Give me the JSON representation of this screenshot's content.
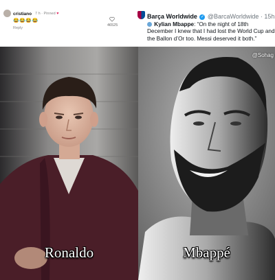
{
  "comment": {
    "username": "cristiano",
    "meta": "7 h · Pinned",
    "emojis": "😂😂😂😂",
    "reply_label": "Reply",
    "like_count": "46525"
  },
  "tweet": {
    "account_name": "Barça Worldwide",
    "handle": "@BarcaWorldwide · 15h",
    "mention": "Kylian Mbappe",
    "quote": ": “On the night of 18th December I knew that I had lost the World Cup and the Ballon d’Or too. Messi deserved it both.”"
  },
  "watermark": "@Sohag",
  "captions": {
    "left": "Ronaldo",
    "right": "Mbappé"
  },
  "colors": {
    "verified": "#1d9bf0",
    "heart": "#e0245e"
  }
}
